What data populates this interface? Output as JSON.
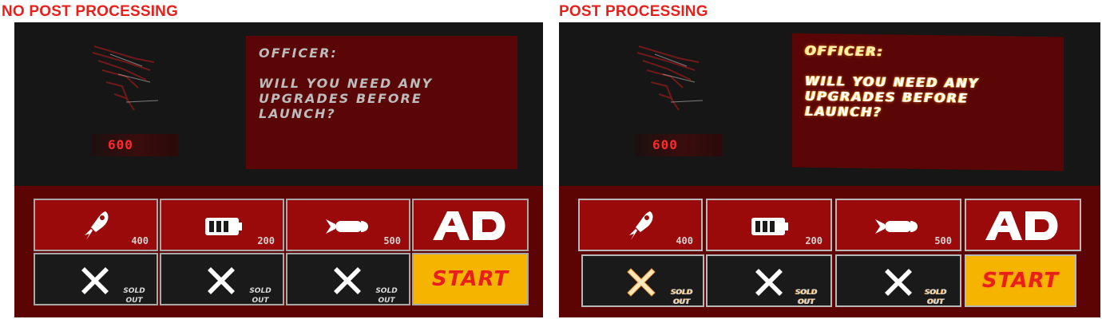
{
  "captions": {
    "left": "NO POST PROCESSING",
    "right": "POST PROCESSING"
  },
  "dialog": {
    "speaker": "OFFICER:",
    "message": "WILL YOU NEED ANY\nUPGRADES BEFORE\nLAUNCH?"
  },
  "credits": "600",
  "upgrades": [
    {
      "icon": "rocket-icon",
      "price": "400"
    },
    {
      "icon": "battery-icon",
      "price": "200"
    },
    {
      "icon": "missile-icon",
      "price": "500"
    },
    {
      "icon": "ad-logo-icon",
      "label": "AD"
    }
  ],
  "sold_out": {
    "line1": "SOLD",
    "line2": "OUT"
  },
  "start_label": "START",
  "colors": {
    "caption": "#e8201c",
    "dialog_bg": "#5a0606",
    "shop_bg": "#5c0303",
    "tile_red": "#9a0a0a",
    "tile_dark": "#1a1a1a",
    "start_bg": "#f5b400",
    "start_text": "#e8201c"
  }
}
